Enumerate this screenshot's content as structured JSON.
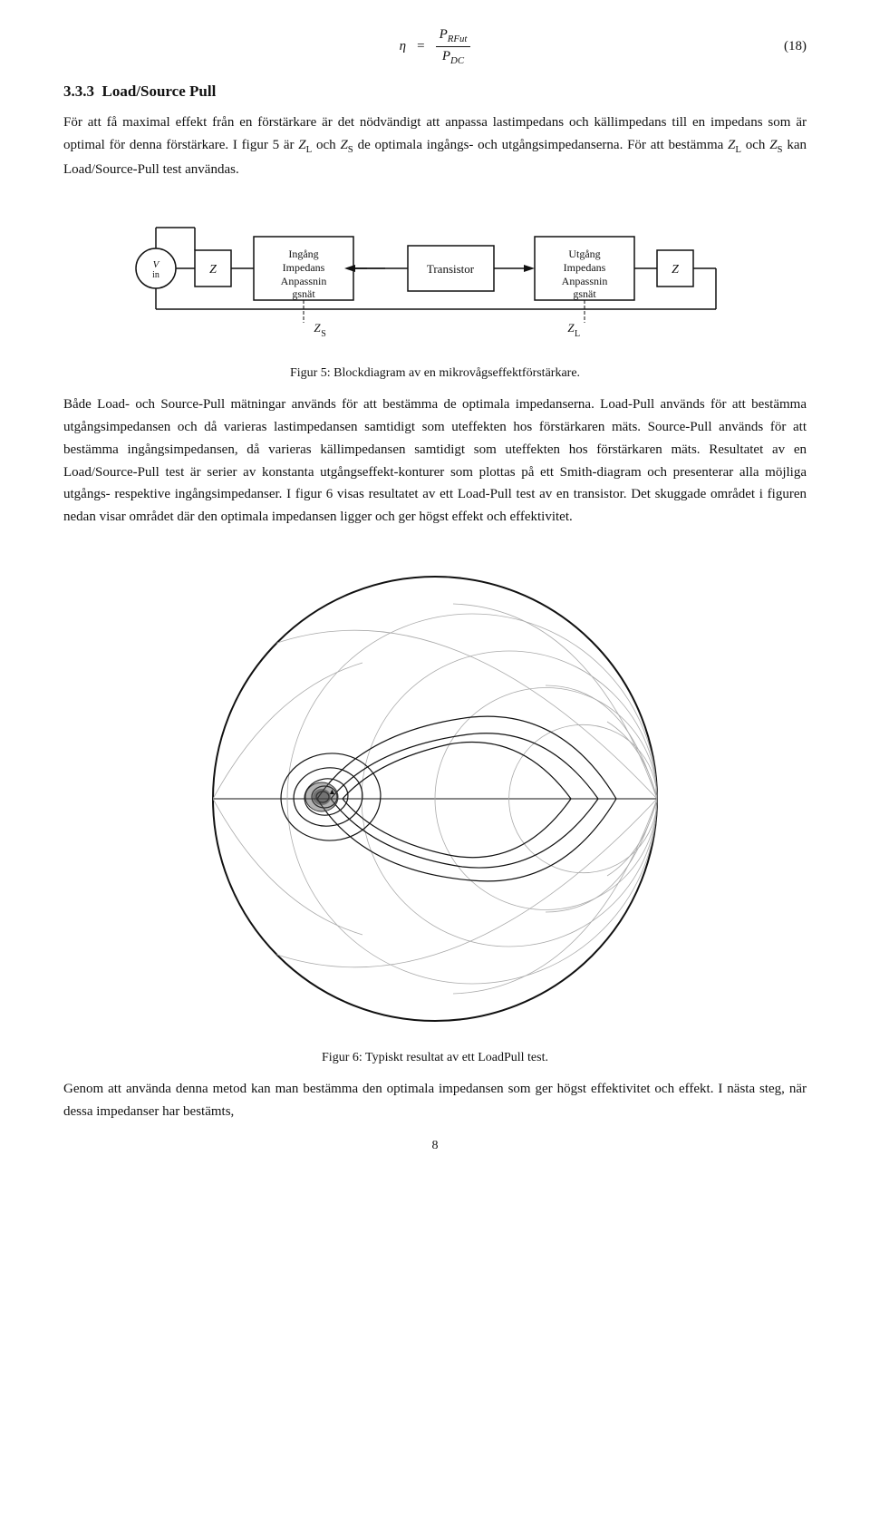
{
  "formula": {
    "eta": "η",
    "equals": "=",
    "numerator": "P",
    "numerator_sub": "RFut",
    "denominator": "P",
    "denominator_sub": "DC",
    "eq_number": "(18)"
  },
  "section": {
    "number": "3.3.3",
    "title": "Load/Source Pull"
  },
  "paragraphs": {
    "p1": "För att få maximal effekt från en förstärkare är det nödvändigt att anpassa lastimpedans och källimpedans till en impedans som är optimal för denna förstärkare. I figur 5 är Z",
    "p1_sub1": "L",
    "p1_mid": " och Z",
    "p1_sub2": "S",
    "p1_end": " de optimala ingångs- och utgångsimpedanserna. För att bestämma Z",
    "p1_sub3": "L",
    "p1_mid2": " och Z",
    "p1_sub4": "S",
    "p1_end2": " kan Load/Source-Pull test användas.",
    "diagram_caption": "Figur 5: Blockdiagram av en mikrovågseffektförstärkare.",
    "p2": "Både Load- och Source-Pull mätningar används för att bestämma de optimala impedanserna. Load-Pull används för att bestämma utgångsimpedansen och då varieras lastimpedansen samtidigt som uteffekten hos förstärkaren mäts. Source-Pull används för att bestämma ingångsimpedansen, då varieras källimpedansen samtidigt som uteffekten hos förstärkaren mäts. Resultatet av en Load/Source-Pull test är serier av konstanta utgångseffekt-konturer som plottas på ett Smith-diagram och presenterar alla möjliga utgångs- respektive ingångsimpedanser. I figur 6 visas resultatet av ett Load-Pull test av en transistor. Det skuggade området i figuren nedan visar området där den optimala impedansen ligger och ger högst effekt och effektivitet.",
    "smith_caption": "Figur 6: Typiskt resultat av ett LoadPull test.",
    "p3": "Genom att använda denna metod kan man bestämma den optimala impedansen som ger högst effektivitet och effekt. I nästa steg, när dessa impedanser har bestämts,",
    "page_number": "8"
  },
  "block_diagram": {
    "vin_label": "V",
    "vin_sub": "in",
    "z_left_label": "Z",
    "ingång_line1": "Ingång",
    "ingång_line2": "Impedans",
    "ingång_line3": "Anpassnin",
    "ingång_line4": "gsnät",
    "transistor_label": "Transistor",
    "utgang_line1": "Utgång",
    "utgang_line2": "Impedans",
    "utgang_line3": "Anpassnin",
    "utgang_line4": "gsnät",
    "z_right_label": "Z",
    "zs_label": "Z",
    "zs_sub": "S",
    "zl_label": "Z",
    "zl_sub": "L"
  }
}
